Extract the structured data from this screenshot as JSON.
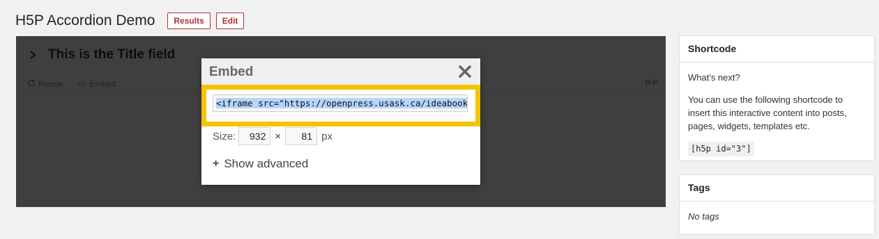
{
  "header": {
    "title": "H5P Accordion Demo",
    "results_label": "Results",
    "edit_label": "Edit"
  },
  "h5p": {
    "accordion_title": "This is the Title field",
    "actions": {
      "reuse_label": "Reuse",
      "embed_label": "Embed"
    },
    "logo_text": "H-P"
  },
  "embed_dialog": {
    "title": "Embed",
    "embed_code": "<iframe src=\"https://openpress.usask.ca/ideabook/",
    "size_label": "Size:",
    "width_value": "932",
    "times_symbol": "×",
    "height_value": "81",
    "unit_label": "px",
    "show_advanced_label": "Show advanced",
    "highlight_color": "#f5c400"
  },
  "sidebar": {
    "shortcode_box": {
      "title": "Shortcode",
      "whats_next": "What's next?",
      "description": "You can use the following shortcode to insert this interactive content into posts, pages, widgets, templates etc.",
      "shortcode": "[h5p id=\"3\"]"
    },
    "tags_box": {
      "title": "Tags",
      "empty_text": "No tags"
    }
  },
  "icons": {
    "accordion_toggle": "chevron-right-icon",
    "reuse": "reuse-icon",
    "embed": "embed-code-icon",
    "close": "close-icon",
    "advanced": "plus-icon"
  },
  "colors": {
    "accent_red": "#b32d2e",
    "overlay_bg": "#3f3f3f",
    "highlight": "#f5c400",
    "selection": "#b4d5fe"
  }
}
